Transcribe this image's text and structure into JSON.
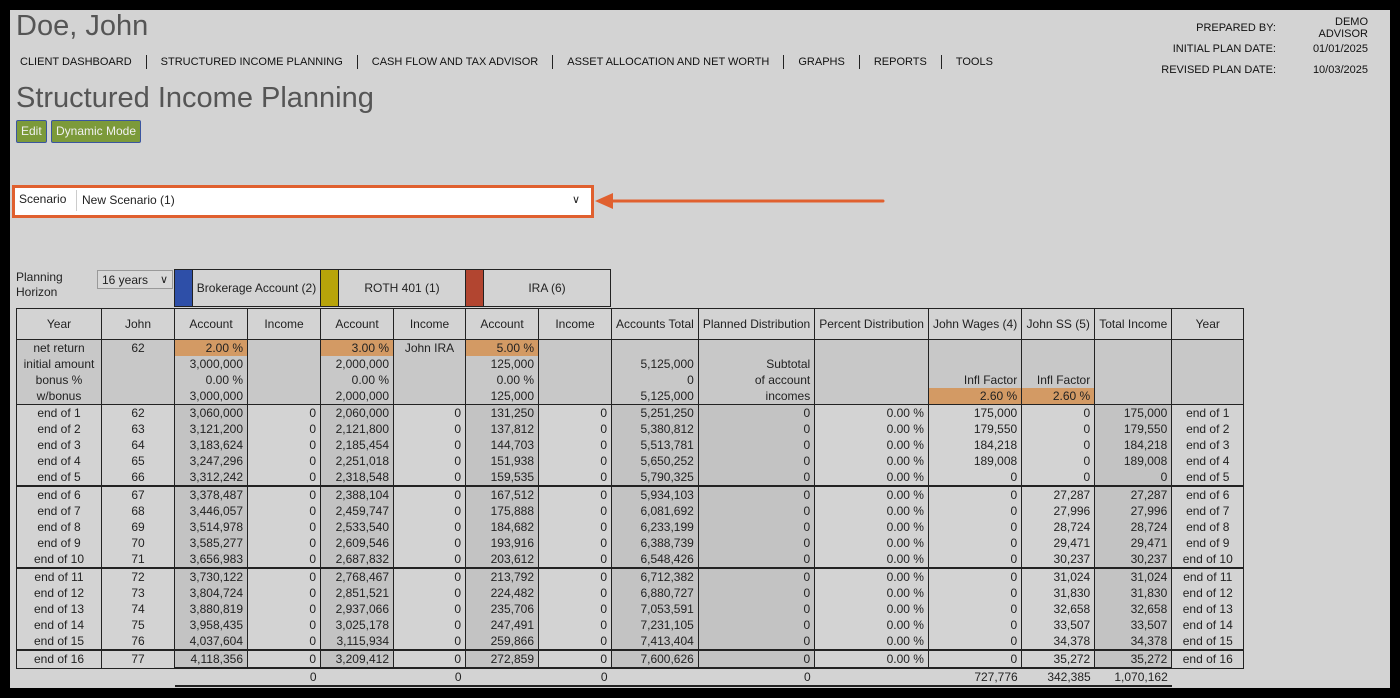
{
  "client_name": "Doe, John",
  "nav": [
    "CLIENT DASHBOARD",
    "STRUCTURED INCOME PLANNING",
    "CASH FLOW AND TAX ADVISOR",
    "ASSET ALLOCATION AND NET WORTH",
    "GRAPHS",
    "REPORTS",
    "TOOLS"
  ],
  "meta": [
    {
      "label": "PREPARED BY:",
      "value": "DEMO ADVISOR"
    },
    {
      "label": "INITIAL PLAN DATE:",
      "value": "01/01/2025"
    },
    {
      "label": "REVISED PLAN DATE:",
      "value": "10/03/2025"
    }
  ],
  "page_title": "Structured Income Planning",
  "buttons": {
    "edit": "Edit",
    "dynamic": "Dynamic Mode"
  },
  "scenario": {
    "label": "Scenario",
    "value": "New Scenario (1)"
  },
  "planning_horizon": {
    "label": "Planning Horizon",
    "value": "16 years"
  },
  "accounts": [
    {
      "name": "Brokerage Account (2)",
      "color": "#2e4fa8"
    },
    {
      "name": "ROTH 401 (1)",
      "color": "#b8a40a"
    },
    {
      "name": "IRA (6)",
      "color": "#b24530"
    }
  ],
  "colors": {
    "highlight": "#e0602f",
    "input_cell": "#d39a64",
    "button": "#7c9a3a"
  },
  "headers": [
    "Year",
    "John",
    "Account",
    "Income",
    "Account",
    "Income",
    "Account",
    "Income",
    "Accounts Total",
    "Planned Distribution",
    "Percent Distribution",
    "John Wages (4)",
    "John SS (5)",
    "Total Income",
    "Year"
  ],
  "setup": [
    [
      "net return",
      "initial amount",
      "bonus %",
      "w/bonus"
    ],
    [
      "62",
      "",
      "",
      ""
    ],
    [
      "2.00  %",
      "3,000,000",
      "0.00  %",
      "3,000,000"
    ],
    [
      "",
      "",
      "",
      ""
    ],
    [
      "3.00  %",
      "2,000,000",
      "0.00  %",
      "2,000,000"
    ],
    [
      "John IRA",
      "",
      "",
      ""
    ],
    [
      "5.00  %",
      "125,000",
      "0.00  %",
      "125,000"
    ],
    [
      "",
      "",
      "",
      ""
    ],
    [
      "",
      "5,125,000",
      "0",
      "5,125,000"
    ],
    [
      "",
      "Subtotal",
      "of account",
      "incomes"
    ],
    [
      "",
      "",
      "",
      ""
    ],
    [
      "",
      "",
      "Infl Factor",
      "2.60  %"
    ],
    [
      "",
      "",
      "Infl Factor",
      "2.60  %"
    ],
    [
      "",
      "",
      "",
      ""
    ],
    [
      "",
      "",
      "",
      ""
    ]
  ],
  "rows": [
    [
      "end of 1",
      "62",
      "3,060,000",
      "0",
      "2,060,000",
      "0",
      "131,250",
      "0",
      "5,251,250",
      "0",
      "0.00  %",
      "175,000",
      "0",
      "175,000",
      "end of 1"
    ],
    [
      "end of 2",
      "63",
      "3,121,200",
      "0",
      "2,121,800",
      "0",
      "137,812",
      "0",
      "5,380,812",
      "0",
      "0.00  %",
      "179,550",
      "0",
      "179,550",
      "end of 2"
    ],
    [
      "end of 3",
      "64",
      "3,183,624",
      "0",
      "2,185,454",
      "0",
      "144,703",
      "0",
      "5,513,781",
      "0",
      "0.00  %",
      "184,218",
      "0",
      "184,218",
      "end of 3"
    ],
    [
      "end of 4",
      "65",
      "3,247,296",
      "0",
      "2,251,018",
      "0",
      "151,938",
      "0",
      "5,650,252",
      "0",
      "0.00  %",
      "189,008",
      "0",
      "189,008",
      "end of 4"
    ],
    [
      "end of 5",
      "66",
      "3,312,242",
      "0",
      "2,318,548",
      "0",
      "159,535",
      "0",
      "5,790,325",
      "0",
      "0.00  %",
      "0",
      "0",
      "0",
      "end of 5"
    ],
    [
      "end of 6",
      "67",
      "3,378,487",
      "0",
      "2,388,104",
      "0",
      "167,512",
      "0",
      "5,934,103",
      "0",
      "0.00  %",
      "0",
      "27,287",
      "27,287",
      "end of 6"
    ],
    [
      "end of 7",
      "68",
      "3,446,057",
      "0",
      "2,459,747",
      "0",
      "175,888",
      "0",
      "6,081,692",
      "0",
      "0.00  %",
      "0",
      "27,996",
      "27,996",
      "end of 7"
    ],
    [
      "end of 8",
      "69",
      "3,514,978",
      "0",
      "2,533,540",
      "0",
      "184,682",
      "0",
      "6,233,199",
      "0",
      "0.00  %",
      "0",
      "28,724",
      "28,724",
      "end of 8"
    ],
    [
      "end of 9",
      "70",
      "3,585,277",
      "0",
      "2,609,546",
      "0",
      "193,916",
      "0",
      "6,388,739",
      "0",
      "0.00  %",
      "0",
      "29,471",
      "29,471",
      "end of 9"
    ],
    [
      "end of 10",
      "71",
      "3,656,983",
      "0",
      "2,687,832",
      "0",
      "203,612",
      "0",
      "6,548,426",
      "0",
      "0.00  %",
      "0",
      "30,237",
      "30,237",
      "end of 10"
    ],
    [
      "end of 11",
      "72",
      "3,730,122",
      "0",
      "2,768,467",
      "0",
      "213,792",
      "0",
      "6,712,382",
      "0",
      "0.00  %",
      "0",
      "31,024",
      "31,024",
      "end of 11"
    ],
    [
      "end of 12",
      "73",
      "3,804,724",
      "0",
      "2,851,521",
      "0",
      "224,482",
      "0",
      "6,880,727",
      "0",
      "0.00  %",
      "0",
      "31,830",
      "31,830",
      "end of 12"
    ],
    [
      "end of 13",
      "74",
      "3,880,819",
      "0",
      "2,937,066",
      "0",
      "235,706",
      "0",
      "7,053,591",
      "0",
      "0.00  %",
      "0",
      "32,658",
      "32,658",
      "end of 13"
    ],
    [
      "end of 14",
      "75",
      "3,958,435",
      "0",
      "3,025,178",
      "0",
      "247,491",
      "0",
      "7,231,105",
      "0",
      "0.00  %",
      "0",
      "33,507",
      "33,507",
      "end of 14"
    ],
    [
      "end of 15",
      "76",
      "4,037,604",
      "0",
      "3,115,934",
      "0",
      "259,866",
      "0",
      "7,413,404",
      "0",
      "0.00  %",
      "0",
      "34,378",
      "34,378",
      "end of 15"
    ],
    [
      "end of 16",
      "77",
      "4,118,356",
      "0",
      "3,209,412",
      "0",
      "272,859",
      "0",
      "7,600,626",
      "0",
      "0.00  %",
      "0",
      "35,272",
      "35,272",
      "end of 16"
    ]
  ],
  "totals": [
    "",
    "",
    "",
    "0",
    "",
    "0",
    "",
    "0",
    "",
    "0",
    "",
    "727,776",
    "342,385",
    "1,070,162",
    ""
  ]
}
